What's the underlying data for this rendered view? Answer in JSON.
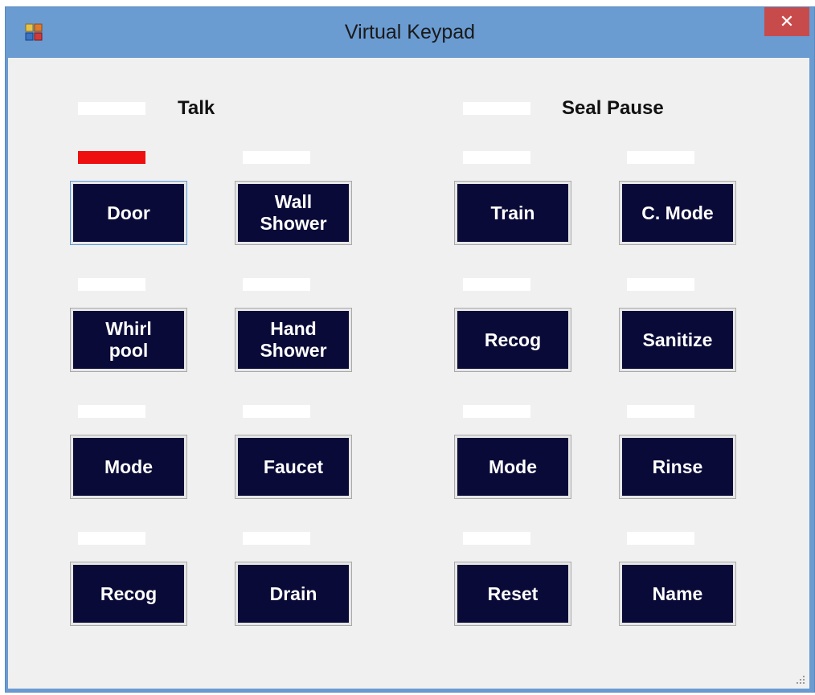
{
  "window": {
    "title": "Virtual Keypad",
    "close_label": "✕"
  },
  "headers": {
    "talk": "Talk",
    "seal_pause": "Seal Pause"
  },
  "keys": {
    "door": "Door",
    "wall_shower": "Wall\nShower",
    "train": "Train",
    "c_mode": "C. Mode",
    "whirlpool": "Whirl\npool",
    "hand_shower": "Hand\nShower",
    "recog_right": "Recog",
    "sanitize": "Sanitize",
    "mode_left": "Mode",
    "faucet": "Faucet",
    "mode_right": "Mode",
    "rinse": "Rinse",
    "recog_left": "Recog",
    "drain": "Drain",
    "reset": "Reset",
    "name": "Name"
  },
  "indicator_states": {
    "door": "on",
    "others": "off"
  },
  "colors": {
    "key_face": "#0a0a38",
    "indicator_on": "#ee1010",
    "indicator_off": "#ffffff",
    "titlebar": "#6a9bd1"
  },
  "icons": {
    "app": "app-icon",
    "close": "close-icon",
    "grip": "resize-grip-icon"
  }
}
